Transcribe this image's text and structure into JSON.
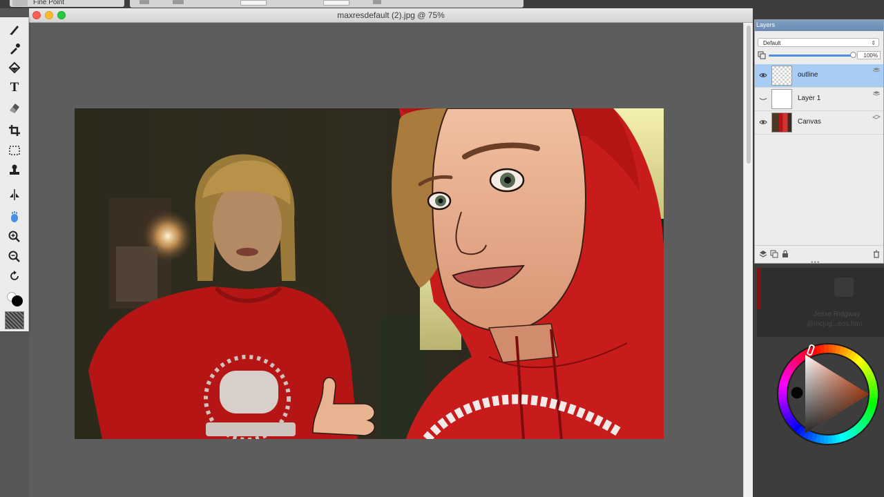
{
  "app": {
    "brush_name": "Fine Point",
    "document_title": "maxresdefault (2).jpg @ 75%"
  },
  "tools": [
    {
      "name": "brush-tool",
      "glyph": "brush"
    },
    {
      "name": "dropper-tool",
      "glyph": "dropper"
    },
    {
      "name": "fill-tool",
      "glyph": "fill"
    },
    {
      "name": "text-tool",
      "glyph": "T"
    },
    {
      "name": "eraser-tool",
      "glyph": "eraser"
    },
    {
      "name": "crop-tool",
      "glyph": "crop"
    },
    {
      "name": "selection-tool",
      "glyph": "marquee"
    },
    {
      "name": "stamp-tool",
      "glyph": "stamp"
    },
    {
      "name": "mirror-tool",
      "glyph": "mirror"
    },
    {
      "name": "grabber-tool",
      "glyph": "hand"
    },
    {
      "name": "zoom-in-tool",
      "glyph": "zoom-in"
    },
    {
      "name": "zoom-out-tool",
      "glyph": "zoom-out"
    },
    {
      "name": "rotate-tool",
      "glyph": "rotate"
    }
  ],
  "colors": {
    "foreground": "#050505",
    "background": "#ffffff",
    "selected_layer": "#a7cdf5",
    "panel_tab": "#6a8ab2"
  },
  "layers_panel": {
    "tab_label": "Layers",
    "composite_method": "Default",
    "opacity_label": "100%",
    "opacity_fraction": 1.0,
    "layers": [
      {
        "name": "outline",
        "selected": true,
        "visible": true,
        "thumb": "checker"
      },
      {
        "name": "Layer 1",
        "selected": false,
        "visible": false,
        "thumb": "blank"
      },
      {
        "name": "Canvas",
        "selected": false,
        "visible": true,
        "thumb": "canvas"
      }
    ]
  },
  "webcam_overlay": {
    "name": "Jesse Ridgway",
    "handle": "@mcjug...eos.htm"
  }
}
